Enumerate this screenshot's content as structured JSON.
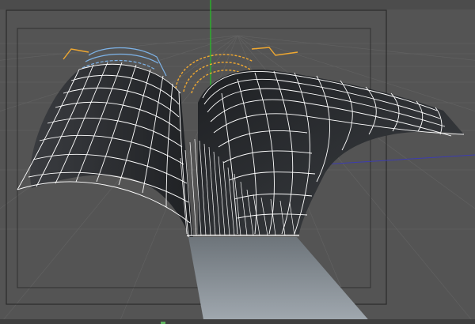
{
  "viewport": {
    "background_color": "#545454",
    "safe_frame_color": "#2e2e2e",
    "render_frame_color": "#2b2b2b",
    "grid_color": "#606060",
    "y_axis_color": "#22c422",
    "x_axis_color": "#3c3cb0",
    "wireframe_color": "#ffffff",
    "selected_spline_color": "#f0a830",
    "selected_cage_color": "#7db3e8",
    "floor_shadow_color": "#8c949c"
  },
  "scene_objects": [
    {
      "name": "curved-sheet-left",
      "type": "wireframe-mesh"
    },
    {
      "name": "curved-sheet-right",
      "type": "wireframe-mesh"
    },
    {
      "name": "spline-path",
      "type": "spline",
      "selected": true
    }
  ]
}
